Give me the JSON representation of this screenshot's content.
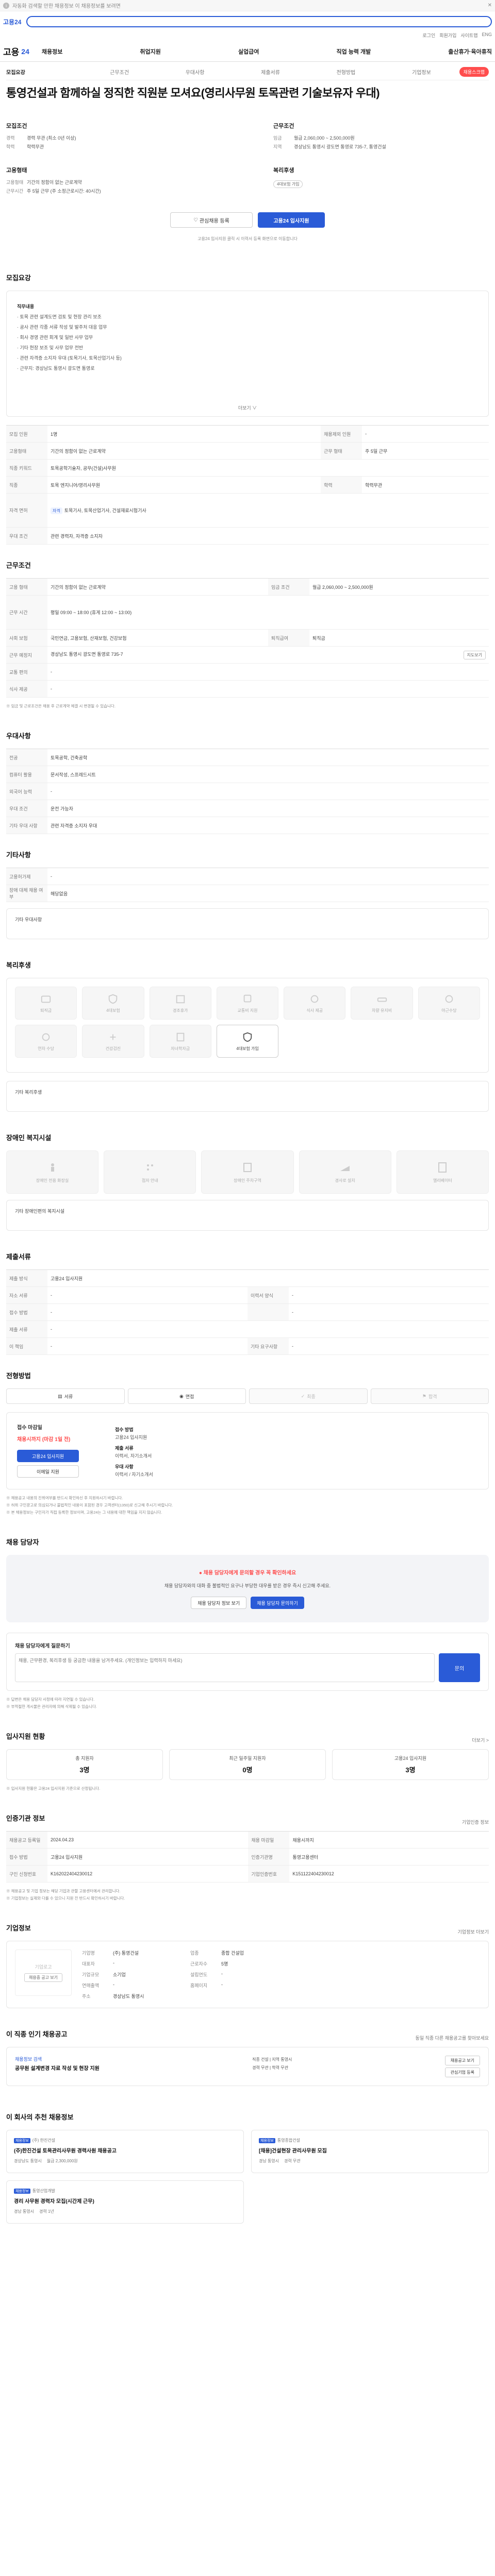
{
  "topbar": {
    "text": "자동화 검색할 만한 채용정보 이 채용정보를 보려면",
    "close": "✕"
  },
  "search": {
    "logo": "고용24",
    "util": [
      "로그인",
      "회원가입",
      "사이트맵",
      "ENG"
    ]
  },
  "gnb": {
    "logo": "고용",
    "logo_num": "24",
    "menu": [
      "채용정보",
      "취업지원",
      "실업급여",
      "직업 능력 개발",
      "출산휴가·육아휴직"
    ]
  },
  "tabs": {
    "items": [
      "모집요강",
      "근무조건",
      "우대사항",
      "제출서류",
      "전형방법",
      "기업정보"
    ],
    "scrap": "채용스크랩"
  },
  "title": "통영건설과 함께하실 정직한 직원분 모셔요(영리사무원 토목관련 기술보유자 우대)",
  "summary": {
    "recruit": {
      "h": "모집조건",
      "rows": [
        [
          "경력",
          "경력 무관 (최소 0년 이상)"
        ],
        [
          "학력",
          "학력무관"
        ]
      ]
    },
    "work": {
      "h": "근무조건",
      "rows": [
        [
          "임금",
          "월급 2,060,000 ~ 2,500,000원"
        ],
        [
          "지역",
          "경상남도 통영시 광도면 통영로 735-7, 통영건설"
        ]
      ]
    },
    "type": {
      "h": "고용형태",
      "rows": [
        [
          "고용형태",
          "기간의 정함이 없는 근로계약"
        ],
        [
          "근무시간",
          "주 5일 근무 (주 소정근로시간: 40시간)"
        ]
      ]
    },
    "welfare": {
      "h": "복리후생",
      "pill": "4대보험 가입"
    }
  },
  "actions": {
    "share": "관심채용 등록",
    "apply": "고용24 입사지원"
  },
  "note": "고용24 입사지원 클릭 시 이력서 등록 화면으로 이동합니다",
  "sections": {
    "desc": "모집요강",
    "cond": "근무조건",
    "pref": "우대사항",
    "extra": "기타사항",
    "welfare": "복리후생",
    "disability": "장애인 복지시설",
    "docs": "제출서류",
    "process": "전형방법",
    "contact": "채용 담당자",
    "apply_status": "입사지원 현황",
    "agency": "인증기관 정보",
    "company": "기업정보",
    "similar": "이 직종 인기 채용공고",
    "reco": "이 회사의 추천 채용정보"
  },
  "desc": {
    "lines": [
      "직무내용",
      "· 토목 관련 설계도면 검토 및 현장 관리 보조",
      "· 공사 관련 각종 서류 작성 및 발주처 대응 업무",
      "· 회사 경영 관련 회계 및 일반 사무 업무",
      "· 기타 현장 보조 및 사무 업무 전반",
      "· 관련 자격증 소지자 우대 (토목기사, 토목산업기사 등)",
      "· 근무지: 경상남도 통영시 광도면 통영로"
    ],
    "more": "더보기 ∨"
  },
  "cond_rows": [
    [
      "모집 인원",
      "1명",
      "채용제외 인원",
      "-"
    ],
    [
      "고용형태",
      "기간의 정함이 없는 근로계약",
      "근무 형태",
      "주 5일 근무"
    ],
    [
      "직종 키워드",
      "토목공학기술자, 공무(건설)사무원",
      "",
      ""
    ],
    [
      "직종",
      "토목 엔지니어/영리사무원",
      "학력",
      "학력무관"
    ],
    [
      "자격 면허",
      "토목기사, 토목산업기사, 건설재료시험기사",
      "",
      ""
    ],
    [
      "우대 조건",
      "관련 경력자, 자격증 소지자",
      "",
      ""
    ]
  ],
  "work_rows": [
    [
      "고용 형태",
      "기간의 정함이 없는 근로계약",
      "임금 조건",
      "월급 2,060,000 ~ 2,500,000원"
    ],
    [
      "근무 시간",
      "평일 09:00 ~ 18:00 (휴게 12:00 ~ 13:00)",
      "",
      ""
    ],
    [
      "사회 보험",
      "국민연금, 고용보험, 산재보험, 건강보험",
      "퇴직급여",
      "퇴직금"
    ],
    [
      "근무 예정지",
      "경상남도 통영시 광도면 통영로 735-7",
      "",
      ""
    ],
    [
      "교통 편의",
      "-",
      "",
      ""
    ],
    [
      "식사 제공",
      "-",
      "",
      ""
    ]
  ],
  "work_note": "※ 임금 및 근로조건은 채용 후 근로계약 체결 시 변경될 수 있습니다.",
  "map_label": "지도보기",
  "pref_rows": [
    [
      "전공",
      "토목공학, 건축공학"
    ],
    [
      "컴퓨터 활용",
      "문서작성, 스프레드시트"
    ],
    [
      "외국어 능력",
      "-"
    ],
    [
      "우대 조건",
      "운전 가능자"
    ],
    [
      "기타 우대 사항",
      "관련 자격증 소지자 우대"
    ]
  ],
  "extra_rows": [
    [
      "고용허가제",
      "-"
    ],
    [
      "장애 대체 채용 여부",
      "해당없음"
    ]
  ],
  "extra_link": "기타 우대사항",
  "welfare_items": [
    {
      "label": "퇴직금",
      "on": false
    },
    {
      "label": "4대보험",
      "on": false
    },
    {
      "label": "경조휴가",
      "on": false
    },
    {
      "label": "교통비 지원",
      "on": false
    },
    {
      "label": "식사 제공",
      "on": false
    },
    {
      "label": "차량 유지비",
      "on": false
    },
    {
      "label": "야근수당",
      "on": false
    },
    {
      "label": "연차 수당",
      "on": false
    },
    {
      "label": "건강검진",
      "on": false
    },
    {
      "label": "자녀학자금",
      "on": false
    },
    {
      "label": "4대보험 가입",
      "on": true
    }
  ],
  "welfare_box": "기타 복리후생",
  "disability_items": [
    "장애인 전용 화장실",
    "점자 안내",
    "장애인 주차구역",
    "경사로 설치",
    "엘리베이터"
  ],
  "disability_box": "기타 장애인편의 복지시설",
  "docs_rows": [
    [
      "제출 방식",
      "고용24 입사지원",
      "",
      ""
    ],
    [
      "자소 서류",
      "-",
      "이력서 양식",
      "-"
    ],
    [
      "접수 방법",
      "-",
      "",
      "-"
    ],
    [
      "제출 서류",
      "-",
      "",
      ""
    ],
    [
      "이 책임",
      "-",
      "기타 요구사항",
      "-"
    ]
  ],
  "process_steps": [
    "서류",
    "면접",
    "최종",
    "합격"
  ],
  "applybox": {
    "h": "접수 마감일",
    "deadline": "채용시까지 (마감 1일 전)",
    "btn1": "고용24 입사지원",
    "btn2": "이메일 지원",
    "r1": "접수 방법",
    "r1v": "고용24 입사지원",
    "r2": "제출 서류",
    "r2v": "이력서, 자기소개서",
    "r3": "우대 사항",
    "r3v": "이력서 / 자기소개서"
  },
  "apply_notes": [
    "※ 채용공고 내용의 진위여부를 반드시 확인하신 후 지원하시기 바랍니다.",
    "※ 허위 구인광고로 의심되거나 불법적인 내용이 포함된 경우 고객센터(1350)로 신고해 주시기 바랍니다.",
    "※ 본 채용정보는 구인자가 직접 등록한 정보이며, 고용24는 그 내용에 대한 책임을 지지 않습니다."
  ],
  "qa": {
    "q1": "● 채용 담당자에게 문의할 경우 꼭 확인하세요",
    "q2": "채용 담당자와의 대화 중 불법적인 요구나 부당한 대우를 받은 경우 즉시 신고해 주세요.",
    "b1": "채용 담당자 정보 보기",
    "b2": "채용 담당자 문의하기"
  },
  "ask": {
    "h": "채용 담당자에게 질문하기",
    "placeholder": "채용, 근무환경, 복리후생 등 궁금한 내용을 남겨주세요. (개인정보는 입력하지 마세요)",
    "btn": "문의"
  },
  "ask_notes": [
    "※ 답변은 채용 담당자 사정에 따라 지연될 수 있습니다.",
    "※ 부적절한 게시물은 관리자에 의해 삭제될 수 있습니다."
  ],
  "apply_status_more": "더보기 >",
  "stats": [
    {
      "k": "총 지원자",
      "v": "3명"
    },
    {
      "k": "최근 일주일 지원자",
      "v": "0명"
    },
    {
      "k": "고용24 입사지원",
      "v": "3명"
    }
  ],
  "stats_note": "※ 입사지원 현황은 고용24 입사지원 기준으로 산정됩니다.",
  "agency_side": "기업인증 정보",
  "agency_rows": [
    [
      "채용공고 등록일",
      "2024.04.23",
      "채용 마감일",
      "채용시까지"
    ],
    [
      "접수 방법",
      "고용24 입사지원",
      "인증기관명",
      "통영고용센터"
    ],
    [
      "구인 신청번호",
      "K162022404230012",
      "기업인증번호",
      "K151122404230012"
    ]
  ],
  "agency_notes": [
    "※ 채용공고 및 기업 정보는 해당 기업과 관할 고용센터에서 관리합니다.",
    "※ 기업정보는 실제와 다를 수 있으니 지원 전 반드시 확인하시기 바랍니다."
  ],
  "company": {
    "more": "기업정보 더보기",
    "logo": "기업로고",
    "logo_btn": "채용중 공고 보기",
    "rows": [
      [
        "기업명",
        "(주) 통영건설",
        "업종",
        "종합 건설업"
      ],
      [
        "대표자",
        "-",
        "근로자수",
        "5명"
      ],
      [
        "기업규모",
        "소기업",
        "설립연도",
        "-"
      ],
      [
        "연매출액",
        "-",
        "홈페이지",
        "-"
      ],
      [
        "주소",
        "경상남도 통영시",
        "",
        ""
      ]
    ]
  },
  "similar": {
    "side": "동일 직종 다른 채용공고를 찾아보세요",
    "t1": "채용정보 검색",
    "t2": "공무원 설계변경 자료 작성 및 현장 지원",
    "mid1": "직종 건설 | 지역 통영시",
    "mid2": "경력 무관 | 학력 무관",
    "b1": "채용공고 보기",
    "b2": "관심기업 등록"
  },
  "reco": [
    {
      "badge": "채용정보",
      "co": "(주) 한진건설",
      "title": "(주)한진건설 토목관리사무원 경력사원 채용공고",
      "meta": [
        "경상남도 통영시",
        "월급 2,300,000원"
      ]
    },
    {
      "badge": "채용정보",
      "co": "통영종합건설",
      "title": "[채용]건설현장 관리사무원 모집",
      "meta": [
        "경남 통영시",
        "경력 무관"
      ]
    },
    {
      "badge": "채용정보",
      "co": "통영산업개발",
      "title": "경리 사무원 경력자 모집(시간제 근무)",
      "meta": [
        "경남 통영시",
        "경력 1년"
      ]
    }
  ]
}
